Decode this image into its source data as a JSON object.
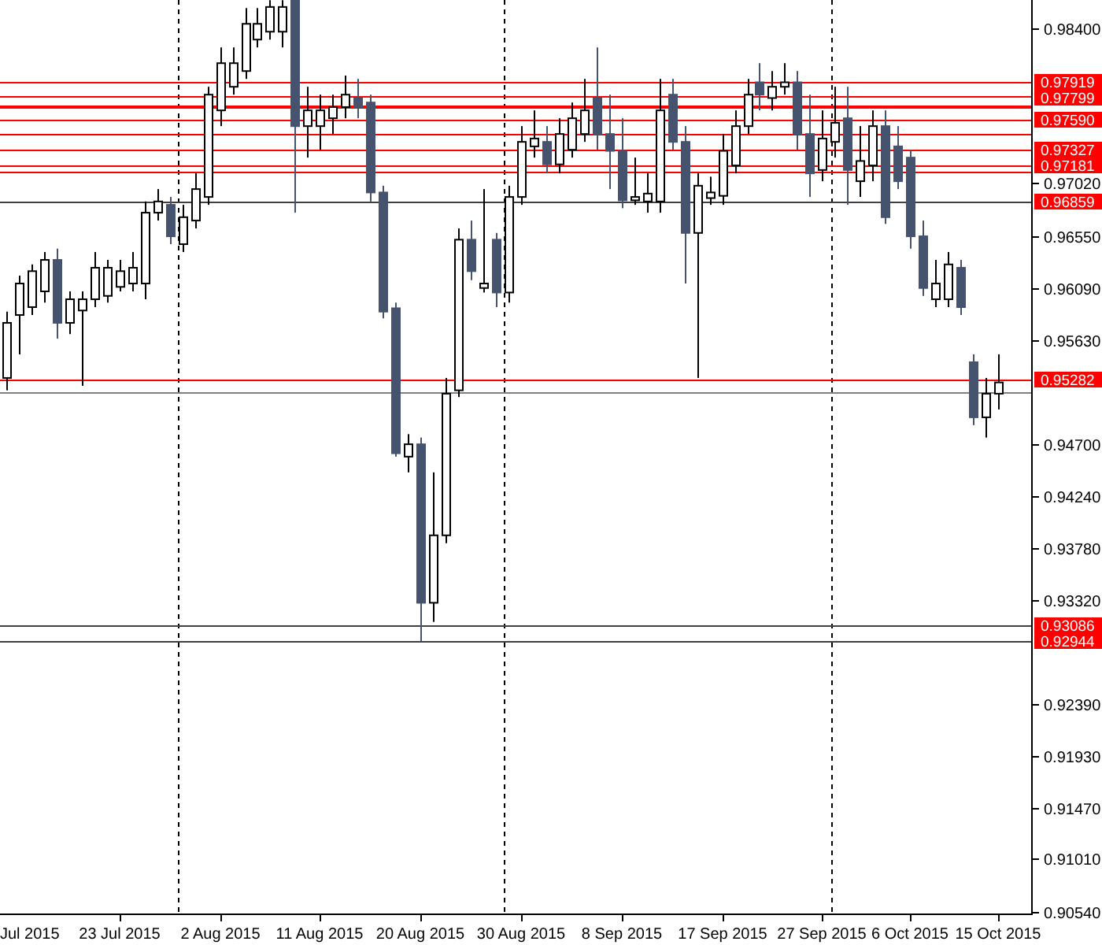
{
  "chart": {
    "chart_data": {
      "type": "candlestick",
      "categories": [
        null,
        null,
        null,
        null,
        null,
        null,
        null,
        null,
        null,
        "23 Jul 2015",
        null,
        null,
        null,
        null,
        null,
        null,
        null,
        "2 Aug 2015",
        null,
        null,
        null,
        null,
        null,
        null,
        null,
        "11 Aug 2015",
        null,
        null,
        null,
        null,
        null,
        null,
        null,
        "20 Aug 2015",
        null,
        null,
        null,
        null,
        null,
        null,
        null,
        "30 Aug 2015",
        null,
        null,
        null,
        null,
        null,
        null,
        null,
        "8 Sep 2015",
        null,
        null,
        null,
        null,
        null,
        null,
        null,
        "17 Sep 2015",
        null,
        null,
        null,
        null,
        null,
        null,
        null,
        "27 Sep 2015",
        null,
        null,
        null,
        null,
        null,
        null,
        "6 Oct 2015",
        null,
        null,
        null,
        null,
        null,
        null,
        "15 Oct 2015"
      ],
      "ohlc": [
        [
          0.9529,
          0.9588,
          0.9518,
          0.9578
        ],
        [
          0.9585,
          0.962,
          0.955,
          0.9613
        ],
        [
          0.9592,
          0.963,
          0.9585,
          0.9624
        ],
        [
          0.9606,
          0.9641,
          0.9596,
          0.9634
        ],
        [
          0.9634,
          0.9644,
          0.9564,
          0.9578
        ],
        [
          0.9578,
          0.9606,
          0.9568,
          0.9599
        ],
        [
          0.9589,
          0.9606,
          0.9522,
          0.9599
        ],
        [
          0.9599,
          0.9641,
          0.9592,
          0.9627
        ],
        [
          0.9602,
          0.9634,
          0.9596,
          0.9627
        ],
        [
          0.961,
          0.9634,
          0.9606,
          0.9624
        ],
        [
          0.9613,
          0.9641,
          0.9606,
          0.9627
        ],
        [
          0.9613,
          0.9686,
          0.9599,
          0.9676
        ],
        [
          0.9676,
          0.9697,
          0.9669,
          0.9686
        ],
        [
          0.9683,
          0.969,
          0.9648,
          0.9655
        ],
        [
          0.9648,
          0.9683,
          0.9641,
          0.9672
        ],
        [
          0.9669,
          0.9711,
          0.9662,
          0.9697
        ],
        [
          0.969,
          0.9788,
          0.9683,
          0.9781
        ],
        [
          0.9767,
          0.9823,
          0.9753,
          0.9809
        ],
        [
          0.9788,
          0.9823,
          0.9781,
          0.9809
        ],
        [
          0.9802,
          0.9858,
          0.9795,
          0.9844
        ],
        [
          0.983,
          0.9858,
          0.9823,
          0.9844
        ],
        [
          0.9837,
          0.9865,
          0.983,
          0.9859
        ],
        [
          0.9837,
          0.9865,
          0.9823,
          0.9859
        ],
        [
          0.9865,
          0.9865,
          0.9676,
          0.9753
        ],
        [
          0.9753,
          0.9788,
          0.9725,
          0.9767
        ],
        [
          0.9753,
          0.9781,
          0.9732,
          0.9767
        ],
        [
          0.976,
          0.9781,
          0.9746,
          0.977
        ],
        [
          0.977,
          0.9798,
          0.976,
          0.9781
        ],
        [
          0.9778,
          0.9795,
          0.976,
          0.977
        ],
        [
          0.9774,
          0.9781,
          0.9686,
          0.9694
        ],
        [
          0.9694,
          0.97,
          0.9582,
          0.9588
        ],
        [
          0.9591,
          0.9596,
          0.9459,
          0.9462
        ],
        [
          0.9459,
          0.9479,
          0.9445,
          0.947
        ],
        [
          0.947,
          0.9476,
          0.9295,
          0.9329
        ],
        [
          0.9329,
          0.9445,
          0.9312,
          0.9389
        ],
        [
          0.9389,
          0.9529,
          0.9382,
          0.9515
        ],
        [
          0.9518,
          0.9662,
          0.9512,
          0.9652
        ],
        [
          0.9652,
          0.9669,
          0.9616,
          0.9624
        ],
        [
          0.9609,
          0.9697,
          0.9605,
          0.9613
        ],
        [
          0.9652,
          0.9658,
          0.9592,
          0.9605
        ],
        [
          0.9605,
          0.97,
          0.9596,
          0.969
        ],
        [
          0.969,
          0.9753,
          0.9683,
          0.9739
        ],
        [
          0.9735,
          0.9767,
          0.9725,
          0.9742
        ],
        [
          0.9739,
          0.9753,
          0.9711,
          0.9719
        ],
        [
          0.9719,
          0.976,
          0.9711,
          0.9746
        ],
        [
          0.9732,
          0.9774,
          0.9725,
          0.976
        ],
        [
          0.9746,
          0.9795,
          0.9739,
          0.9767
        ],
        [
          0.9778,
          0.9823,
          0.9732,
          0.9746
        ],
        [
          0.9746,
          0.9781,
          0.9697,
          0.9731
        ],
        [
          0.9731,
          0.976,
          0.968,
          0.9687
        ],
        [
          0.9687,
          0.9725,
          0.9683,
          0.969
        ],
        [
          0.9686,
          0.9711,
          0.9676,
          0.9693
        ],
        [
          0.9686,
          0.9795,
          0.9676,
          0.9767
        ],
        [
          0.9781,
          0.9795,
          0.9732,
          0.9739
        ],
        [
          0.9739,
          0.9753,
          0.9613,
          0.9658
        ],
        [
          0.9658,
          0.9711,
          0.9529,
          0.97
        ],
        [
          0.9689,
          0.9708,
          0.9683,
          0.9694
        ],
        [
          0.9691,
          0.9746,
          0.9683,
          0.9731
        ],
        [
          0.9718,
          0.9767,
          0.9711,
          0.9753
        ],
        [
          0.9753,
          0.9795,
          0.9746,
          0.9781
        ],
        [
          0.9792,
          0.9809,
          0.9767,
          0.9781
        ],
        [
          0.9778,
          0.9802,
          0.9767,
          0.9788
        ],
        [
          0.9788,
          0.9809,
          0.9781,
          0.9792
        ],
        [
          0.9792,
          0.9802,
          0.9732,
          0.9746
        ],
        [
          0.9746,
          0.9781,
          0.969,
          0.9711
        ],
        [
          0.9714,
          0.9767,
          0.9704,
          0.9742
        ],
        [
          0.9739,
          0.9788,
          0.9725,
          0.9756
        ],
        [
          0.976,
          0.9788,
          0.9683,
          0.9714
        ],
        [
          0.9704,
          0.9753,
          0.969,
          0.9722
        ],
        [
          0.9718,
          0.9767,
          0.9704,
          0.9753
        ],
        [
          0.9753,
          0.9767,
          0.9666,
          0.9672
        ],
        [
          0.9735,
          0.9753,
          0.9697,
          0.9704
        ],
        [
          0.9725,
          0.9732,
          0.9644,
          0.9655
        ],
        [
          0.9655,
          0.9669,
          0.9602,
          0.9609
        ],
        [
          0.9599,
          0.9634,
          0.9592,
          0.9613
        ],
        [
          0.9599,
          0.9641,
          0.9592,
          0.963
        ],
        [
          0.9627,
          0.9634,
          0.9585,
          0.9592
        ],
        [
          0.9543,
          0.955,
          0.9487,
          0.9494
        ],
        [
          0.9494,
          0.9529,
          0.9476,
          0.9515
        ],
        [
          0.9515,
          0.955,
          0.9501,
          0.9525
        ]
      ],
      "ylim": [
        0.90526,
        0.98652
      ],
      "ref_lines": [
        {
          "axis": "y",
          "value": 0.97919,
          "label": "0.97919",
          "color": "#ff0000"
        },
        {
          "axis": "y",
          "value": 0.97799,
          "label": "0.97799",
          "color": "#ff0000"
        },
        {
          "axis": "y",
          "value": 0.9772,
          "color": "#ff0000"
        },
        {
          "axis": "y",
          "value": 0.977,
          "color": "#ff0000"
        },
        {
          "axis": "y",
          "value": 0.9759,
          "label": "0.97590",
          "color": "#ff0000"
        },
        {
          "axis": "y",
          "value": 0.97455,
          "color": "#ff0000"
        },
        {
          "axis": "y",
          "value": 0.97327,
          "label": "0.97327",
          "color": "#ff0000"
        },
        {
          "axis": "y",
          "value": 0.97181,
          "label": "0.97181",
          "color": "#ff0000"
        },
        {
          "axis": "y",
          "value": 0.9712,
          "color": "#ff0000"
        },
        {
          "axis": "y",
          "value": 0.96859,
          "label": "0.96859",
          "color": "#404040"
        },
        {
          "axis": "y",
          "value": 0.95282,
          "label": "0.95282",
          "color": "#ff0000"
        },
        {
          "axis": "y",
          "value": 0.9517,
          "color": "#808080"
        },
        {
          "axis": "y",
          "value": 0.93086,
          "label": "0.93086",
          "color": "#404040"
        },
        {
          "axis": "y",
          "value": 0.92944,
          "label": "0.92944",
          "color": "#404040"
        }
      ],
      "yticks": [
        {
          "value": 0.984,
          "label": "0.98400"
        },
        {
          "value": 0.9702,
          "label": "0.97020"
        },
        {
          "value": 0.9655,
          "label": "0.96550"
        },
        {
          "value": 0.9609,
          "label": "0.96090"
        },
        {
          "value": 0.9563,
          "label": "0.95630"
        },
        {
          "value": 0.947,
          "label": "0.94700"
        },
        {
          "value": 0.9424,
          "label": "0.94240"
        },
        {
          "value": 0.9378,
          "label": "0.93780"
        },
        {
          "value": 0.9332,
          "label": "0.93320"
        },
        {
          "value": 0.9239,
          "label": "0.92390"
        },
        {
          "value": 0.9193,
          "label": "0.91930"
        },
        {
          "value": 0.9147,
          "label": "0.91470"
        },
        {
          "value": 0.9101,
          "label": "0.91010"
        },
        {
          "value": 0.9054,
          "label": "0.90540"
        }
      ]
    },
    "cut_date_label": "Jul 2015"
  }
}
